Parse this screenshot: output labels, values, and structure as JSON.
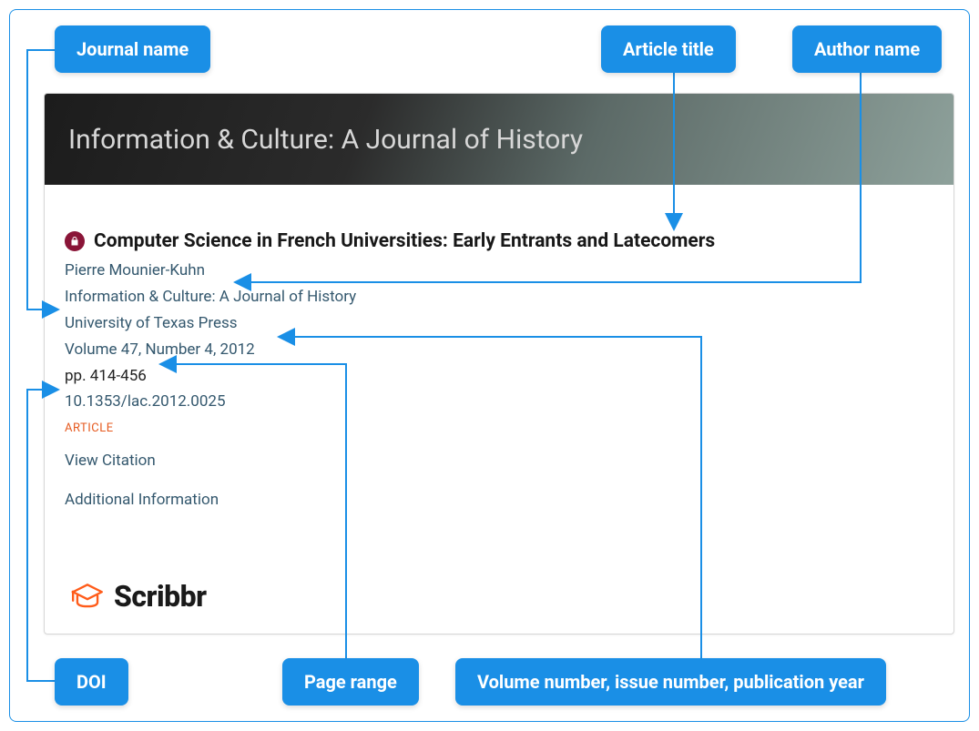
{
  "tags": {
    "journal_name": "Journal name",
    "article_title": "Article title",
    "author_name": "Author name",
    "doi": "DOI",
    "page_range": "Page range",
    "volume_issue_year": "Volume number, issue number, publication year"
  },
  "banner": {
    "title": "Information & Culture: A Journal of History"
  },
  "article": {
    "title": "Computer Science in French Universities: Early Entrants and Latecomers",
    "author": "Pierre Mounier-Kuhn",
    "journal": "Information & Culture: A Journal of History",
    "publisher": "University of Texas Press",
    "volume_line": "Volume 47, Number 4, 2012",
    "pages": "pp. 414-456",
    "doi": "10.1353/lac.2012.0025",
    "type_badge": "ARTICLE",
    "view_citation": "View Citation",
    "additional_info": "Additional Information"
  },
  "brand": {
    "name": "Scribbr"
  }
}
